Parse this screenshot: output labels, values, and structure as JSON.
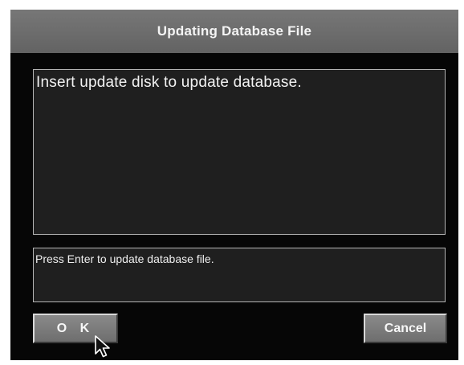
{
  "dialog": {
    "title": "Updating Database File",
    "message": "Insert update disk to update database.",
    "status": "Press Enter to update database file.",
    "ok_label": "O K",
    "cancel_label": "Cancel"
  },
  "colors": {
    "window_bg": "#060606",
    "titlebar_bg": "#6b6b6b",
    "panel_bg": "#1f1f1f",
    "panel_border": "#b5b5b5",
    "button_bg": "#7a7a7a",
    "text": "#f2f2f2"
  },
  "icons": {
    "cursor": "mouse-pointer-icon"
  }
}
